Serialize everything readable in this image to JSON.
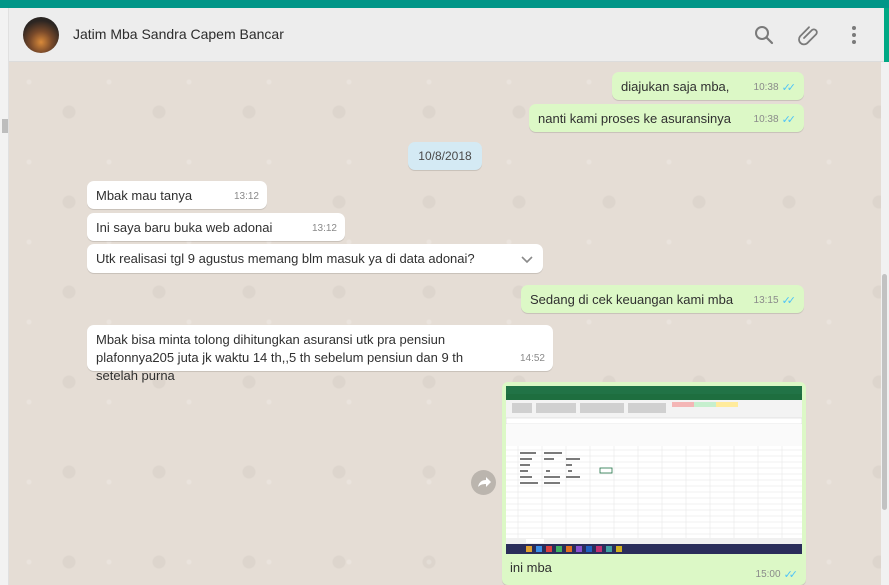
{
  "header": {
    "contact_name": "Jatim Mba Sandra Capem Bancar",
    "icons": [
      "search-icon",
      "paperclip-icon",
      "menu-icon"
    ]
  },
  "messages": [
    {
      "dir": "out",
      "text": "diajukan saja mba,",
      "time": "10:38",
      "ticks": "read"
    },
    {
      "dir": "out",
      "text": "nanti kami proses ke asuransinya",
      "time": "10:38",
      "ticks": "read"
    },
    {
      "dir": "out",
      "text": "Sedang di cek keuangan kami mba",
      "time": "13:15",
      "ticks": "read"
    },
    {
      "dir": "in",
      "text": "Mbak mau tanya",
      "time": "13:12"
    },
    {
      "dir": "in",
      "text": "Ini saya baru buka web adonai",
      "time": "13:12"
    },
    {
      "dir": "in",
      "text": "Utk realisasi tgl 9 agustus memang blm masuk ya di data adonai?",
      "time": ""
    },
    {
      "dir": "in",
      "text": "Mbak bisa minta tolong dihitungkan asuransi utk pra pensiun plafonnya205 juta jk waktu 14 th,,5 th sebelum pensiun dan 9 th setelah purna",
      "time": "14:52"
    }
  ],
  "date_separator": "10/8/2018",
  "image_message": {
    "caption": "ini mba",
    "time": "15:00",
    "ticks": "read"
  },
  "colors": {
    "accent": "#009688",
    "outgoing_bubble": "#dcf8c6",
    "incoming_bubble": "#ffffff",
    "chat_bg": "#e5ddd5",
    "read_ticks": "#4fc3f7"
  }
}
